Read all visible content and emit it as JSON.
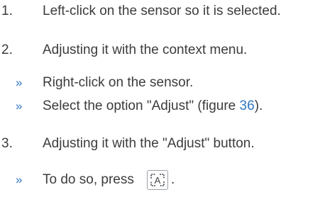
{
  "steps": [
    {
      "number": "1.",
      "text": "Left-click on the sensor so it is selected."
    },
    {
      "number": "2.",
      "text": "Adjusting it with the context menu."
    },
    {
      "number": "3.",
      "text": "Adjusting it with the \"Adjust\" button."
    }
  ],
  "substeps_2": [
    {
      "bullet": "»",
      "text": "Right-click on the sensor."
    },
    {
      "bullet": "»",
      "text_before": "Select the option \"Adjust\" (figure ",
      "link": "36",
      "text_after": ")."
    }
  ],
  "substeps_3": [
    {
      "bullet": "»",
      "text": "To do so, press",
      "icon": "adjust-icon",
      "icon_letter": "A",
      "text_after": "."
    }
  ],
  "colors": {
    "text": "#3c3c3c",
    "accent": "#2f78c4",
    "icon_border": "#9aa0a6"
  }
}
